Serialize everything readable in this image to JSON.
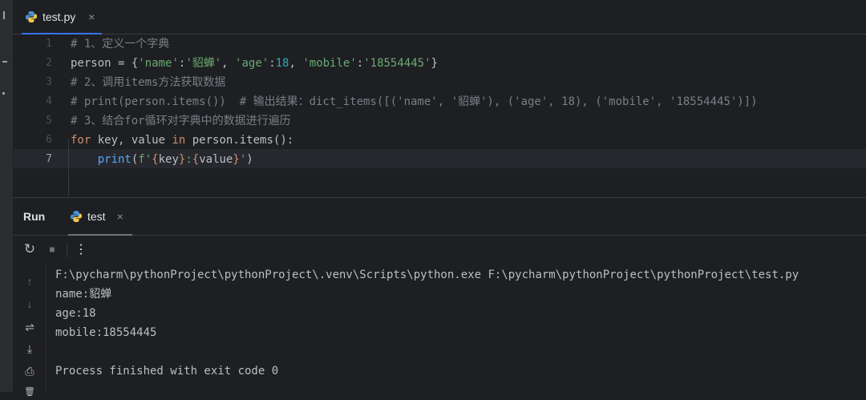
{
  "left_strip": {
    "icons": [
      "folder-icon",
      "structure-icon",
      "dot-icon"
    ]
  },
  "editor_tab": {
    "title": "test.py",
    "icon": "python-icon",
    "close": "×"
  },
  "editor": {
    "line_numbers": [
      "1",
      "2",
      "3",
      "4",
      "5",
      "6",
      "7"
    ],
    "active_line": "7",
    "lines": [
      {
        "tokens": [
          {
            "t": "c-comment",
            "v": "# 1、定义一个字典"
          }
        ]
      },
      {
        "tokens": [
          {
            "t": "c-plain",
            "v": "person = {"
          },
          {
            "t": "c-str",
            "v": "'name'"
          },
          {
            "t": "c-plain",
            "v": ":"
          },
          {
            "t": "c-str",
            "v": "'貂蝉'"
          },
          {
            "t": "c-plain",
            "v": ", "
          },
          {
            "t": "c-str",
            "v": "'age'"
          },
          {
            "t": "c-plain",
            "v": ":"
          },
          {
            "t": "c-num",
            "v": "18"
          },
          {
            "t": "c-plain",
            "v": ", "
          },
          {
            "t": "c-str",
            "v": "'mobile'"
          },
          {
            "t": "c-plain",
            "v": ":"
          },
          {
            "t": "c-str",
            "v": "'18554445'"
          },
          {
            "t": "c-plain",
            "v": "}"
          }
        ]
      },
      {
        "tokens": [
          {
            "t": "c-comment",
            "v": "# 2、调用items方法获取数据"
          }
        ]
      },
      {
        "tokens": [
          {
            "t": "c-comment",
            "v": "# print(person.items())  # 输出结果：dict_items([('name', '貂蝉'), ('age', 18), ('mobile', '18554445')])"
          }
        ]
      },
      {
        "tokens": [
          {
            "t": "c-comment",
            "v": "# 3、结合for循环对字典中的数据进行遍历"
          }
        ]
      },
      {
        "tokens": [
          {
            "t": "c-kw",
            "v": "for"
          },
          {
            "t": "c-plain",
            "v": " key, value "
          },
          {
            "t": "c-kw",
            "v": "in"
          },
          {
            "t": "c-plain",
            "v": " person.items():"
          }
        ]
      },
      {
        "tokens": [
          {
            "t": "c-plain",
            "v": "    "
          },
          {
            "t": "c-fn",
            "v": "print"
          },
          {
            "t": "c-plain",
            "v": "("
          },
          {
            "t": "c-str",
            "v": "f'"
          },
          {
            "t": "c-brace",
            "v": "{"
          },
          {
            "t": "c-plain",
            "v": "key"
          },
          {
            "t": "c-brace",
            "v": "}"
          },
          {
            "t": "c-str",
            "v": ":"
          },
          {
            "t": "c-brace",
            "v": "{"
          },
          {
            "t": "c-plain",
            "v": "value"
          },
          {
            "t": "c-brace",
            "v": "}"
          },
          {
            "t": "c-str",
            "v": "'"
          },
          {
            "t": "c-plain",
            "v": ")"
          }
        ]
      }
    ]
  },
  "run_panel": {
    "label": "Run",
    "tab_title": "test",
    "tab_icon": "python-icon",
    "tab_close": "×",
    "toolbar": {
      "rerun_icon": "↻",
      "stop_icon": "■",
      "more_icon": "⋮"
    },
    "sidebar_icons": [
      "↑",
      "↓",
      "⇌",
      "⤓",
      "⎙",
      "🗑"
    ],
    "output": [
      "F:\\pycharm\\pythonProject\\pythonProject\\.venv\\Scripts\\python.exe F:\\pycharm\\pythonProject\\pythonProject\\test.py",
      "name:貂蝉",
      "age:18",
      "mobile:18554445",
      "",
      "Process finished with exit code 0"
    ]
  },
  "colors": {
    "background": "#1e1f22",
    "accent": "#3574f0",
    "string": "#6aab73",
    "number": "#2aacb8",
    "keyword": "#cf8e6d",
    "comment": "#7a7e85",
    "function": "#56a8f5"
  }
}
